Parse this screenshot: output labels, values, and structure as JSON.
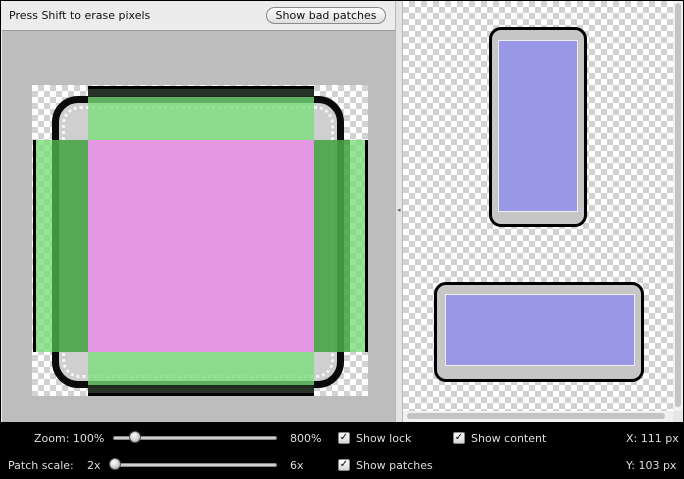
{
  "toolbar": {
    "hint_text": "Press Shift to erase pixels",
    "bad_patches_label": "Show bad patches"
  },
  "colors": {
    "patch_fill": "#e597e1",
    "stretch_region": "#93e393",
    "stretch_overlap": "#4da34d",
    "content_preview": "#9898e6",
    "control_bar": "#000000"
  },
  "icons": {
    "divider_grip": "resize-grip-icon",
    "checkbox_check": "checkmark-icon"
  },
  "controls": {
    "zoom_label": "Zoom: 100%",
    "zoom_max_label": "800%",
    "zoom_level_pct": 100,
    "patch_scale_label": "Patch scale:",
    "patch_scale_min": "2x",
    "patch_scale_max": "6x",
    "patch_scale_value": 2,
    "check_glyph": "✓",
    "show_lock_label": "Show lock",
    "show_lock_checked": true,
    "show_content_label": "Show content",
    "show_content_checked": true,
    "show_patches_label": "Show patches",
    "show_patches_checked": true,
    "x_readout": "X: 111 px",
    "y_readout": "Y: 103 px"
  }
}
